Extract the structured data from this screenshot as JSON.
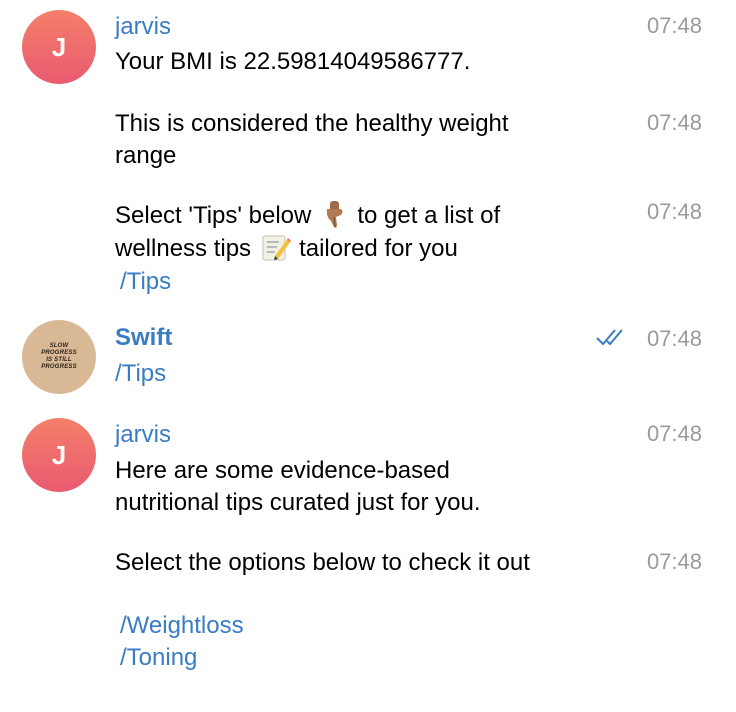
{
  "messages": [
    {
      "avatar_letter": "J",
      "name": "jarvis",
      "text": "Your BMI is 22.59814049586777.",
      "time": "07:48"
    },
    {
      "text": "This is considered the healthy weight range",
      "time": "07:48"
    },
    {
      "text_part1": "Select 'Tips' below",
      "text_part2": "to get a list of wellness tips",
      "text_part3": "tailored for you",
      "time": "07:48",
      "command": "/Tips"
    },
    {
      "avatar_text": "SLOW PROGRESS IS STILL PROGRESS",
      "name": "Swift",
      "text": "/Tips",
      "time": "07:48"
    },
    {
      "avatar_letter": "J",
      "name": "jarvis",
      "text": "Here are some evidence-based nutritional tips curated just for you.",
      "time": "07:48"
    },
    {
      "text": "Select the options below to check it out",
      "time": "07:48",
      "commands": [
        "/Weightloss",
        "/Toning"
      ]
    }
  ],
  "colors": {
    "accent": "#3a7cc4",
    "time": "#9a9a9a",
    "avatar_gradient_top": "#f47f6a",
    "avatar_gradient_bottom": "#ea5a70",
    "swift_avatar": "#d8b895"
  },
  "icons": {
    "point": "backhand-index-pointing-down-icon",
    "memo": "memo-icon",
    "read": "double-check-icon"
  }
}
